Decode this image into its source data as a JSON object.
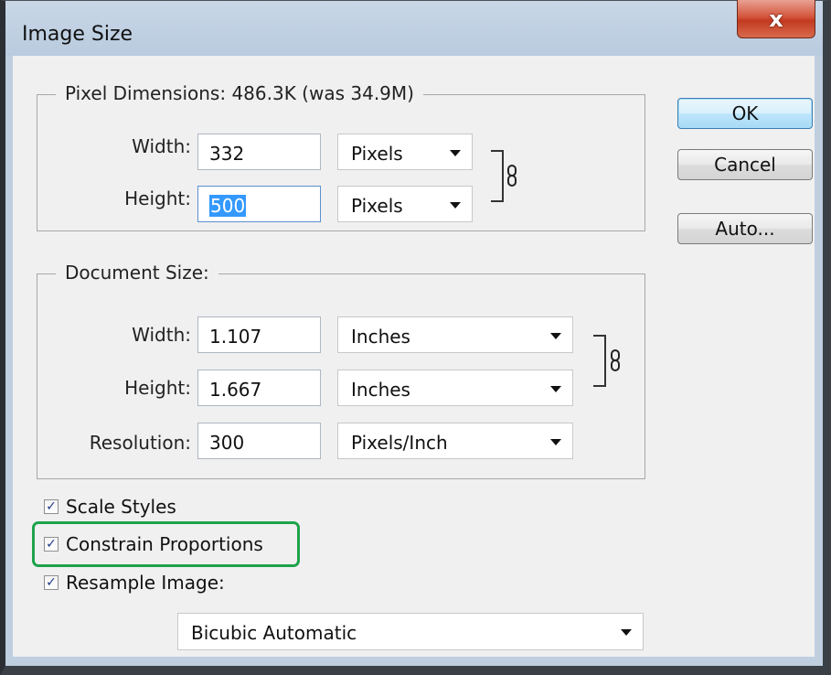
{
  "window": {
    "title": "Image Size",
    "close_glyph": "x"
  },
  "pixel_dimensions": {
    "title": "Pixel Dimensions:  486.3K (was 34.9M)",
    "width_label": "Width:",
    "width_value": "332",
    "width_unit": "Pixels",
    "height_label": "Height:",
    "height_value": "500",
    "height_unit": "Pixels",
    "link_icon": "chain-link-icon"
  },
  "document_size": {
    "title": "Document Size:",
    "width_label": "Width:",
    "width_value": "1.107",
    "width_unit": "Inches",
    "height_label": "Height:",
    "height_value": "1.667",
    "height_unit": "Inches",
    "resolution_label": "Resolution:",
    "resolution_value": "300",
    "resolution_unit": "Pixels/Inch",
    "link_icon": "chain-link-icon"
  },
  "buttons": {
    "ok": "OK",
    "cancel": "Cancel",
    "auto": "Auto..."
  },
  "options": {
    "scale_styles": {
      "label": "Scale Styles",
      "checked": true
    },
    "constrain_proportions": {
      "label": "Constrain Proportions",
      "checked": true
    },
    "resample_image": {
      "label": "Resample Image:",
      "checked": true
    },
    "resample_method": "Bicubic Automatic",
    "check_glyph": "✓"
  },
  "colors": {
    "highlight_outline": "#1ea34b",
    "selection": "#3399ff",
    "close_button": "#c94a30"
  }
}
